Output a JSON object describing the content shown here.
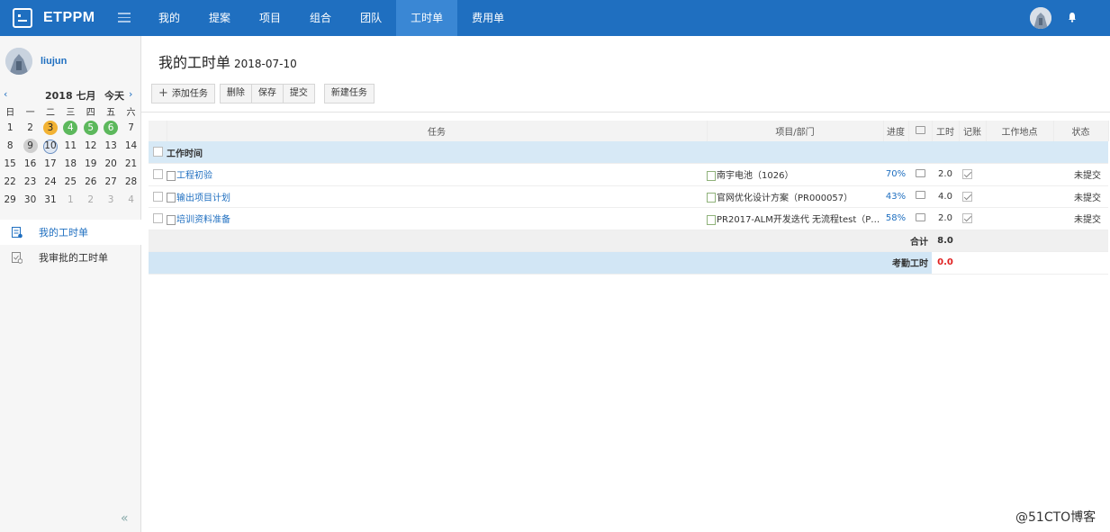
{
  "app": {
    "name": "ETPPM"
  },
  "nav": [
    {
      "label": "我的",
      "active": false
    },
    {
      "label": "提案",
      "active": false
    },
    {
      "label": "项目",
      "active": false
    },
    {
      "label": "组合",
      "active": false
    },
    {
      "label": "团队",
      "active": false
    },
    {
      "label": "工时单",
      "active": true
    },
    {
      "label": "费用单",
      "active": false
    }
  ],
  "user": {
    "name": "liujun"
  },
  "calendar": {
    "title": "2018 七月",
    "today_label": "今天",
    "weekdays": [
      "日",
      "一",
      "二",
      "三",
      "四",
      "五",
      "六"
    ],
    "weeks": [
      [
        {
          "d": "1",
          "s": ""
        },
        {
          "d": "2",
          "s": ""
        },
        {
          "d": "3",
          "s": "orange"
        },
        {
          "d": "4",
          "s": "green"
        },
        {
          "d": "5",
          "s": "green"
        },
        {
          "d": "6",
          "s": "green"
        },
        {
          "d": "7",
          "s": ""
        }
      ],
      [
        {
          "d": "8",
          "s": ""
        },
        {
          "d": "9",
          "s": "grey"
        },
        {
          "d": "10",
          "s": "sel"
        },
        {
          "d": "11",
          "s": ""
        },
        {
          "d": "12",
          "s": ""
        },
        {
          "d": "13",
          "s": ""
        },
        {
          "d": "14",
          "s": ""
        }
      ],
      [
        {
          "d": "15",
          "s": ""
        },
        {
          "d": "16",
          "s": ""
        },
        {
          "d": "17",
          "s": ""
        },
        {
          "d": "18",
          "s": ""
        },
        {
          "d": "19",
          "s": ""
        },
        {
          "d": "20",
          "s": ""
        },
        {
          "d": "21",
          "s": ""
        }
      ],
      [
        {
          "d": "22",
          "s": ""
        },
        {
          "d": "23",
          "s": ""
        },
        {
          "d": "24",
          "s": ""
        },
        {
          "d": "25",
          "s": ""
        },
        {
          "d": "26",
          "s": ""
        },
        {
          "d": "27",
          "s": ""
        },
        {
          "d": "28",
          "s": ""
        }
      ],
      [
        {
          "d": "29",
          "s": ""
        },
        {
          "d": "30",
          "s": ""
        },
        {
          "d": "31",
          "s": ""
        },
        {
          "d": "1",
          "s": "other"
        },
        {
          "d": "2",
          "s": "other"
        },
        {
          "d": "3",
          "s": "other"
        },
        {
          "d": "4",
          "s": "other"
        }
      ]
    ]
  },
  "side_menu": [
    {
      "label": "我的工时单",
      "active": true
    },
    {
      "label": "我审批的工时单",
      "active": false
    }
  ],
  "page": {
    "title": "我的工时单",
    "date": "2018-07-10"
  },
  "toolbar": {
    "add_label": "添加任务",
    "delete_label": "删除",
    "save_label": "保存",
    "submit_label": "提交",
    "new_label": "新建任务"
  },
  "table": {
    "headers": {
      "task": "任务",
      "project": "项目/部门",
      "progress": "进度",
      "hours": "工时",
      "billable": "记账",
      "location": "工作地点",
      "status": "状态"
    },
    "group_label": "工作时间",
    "rows": [
      {
        "task": "工程初验",
        "project": "南宇电池（1026）",
        "progress": "70%",
        "hours": "2.0",
        "billable": true,
        "location": "",
        "status": "未提交"
      },
      {
        "task": "输出项目计划",
        "project": "官网优化设计方案（PR000057）",
        "progress": "43%",
        "hours": "4.0",
        "billable": true,
        "location": "",
        "status": "未提交"
      },
      {
        "task": "培训资料准备",
        "project": "PR2017-ALM开发迭代 无流程test（PR20...",
        "progress": "58%",
        "hours": "2.0",
        "billable": true,
        "location": "",
        "status": "未提交"
      }
    ],
    "total_label": "合计",
    "total_value": "8.0",
    "attendance_label": "考勤工时",
    "attendance_value": "0.0"
  },
  "watermark": "@51CTO博客",
  "colors": {
    "primary": "#1f6fc0",
    "nav_active": "#3a87d4",
    "group_bg": "#d7e9f6",
    "alert": "#e02020"
  }
}
